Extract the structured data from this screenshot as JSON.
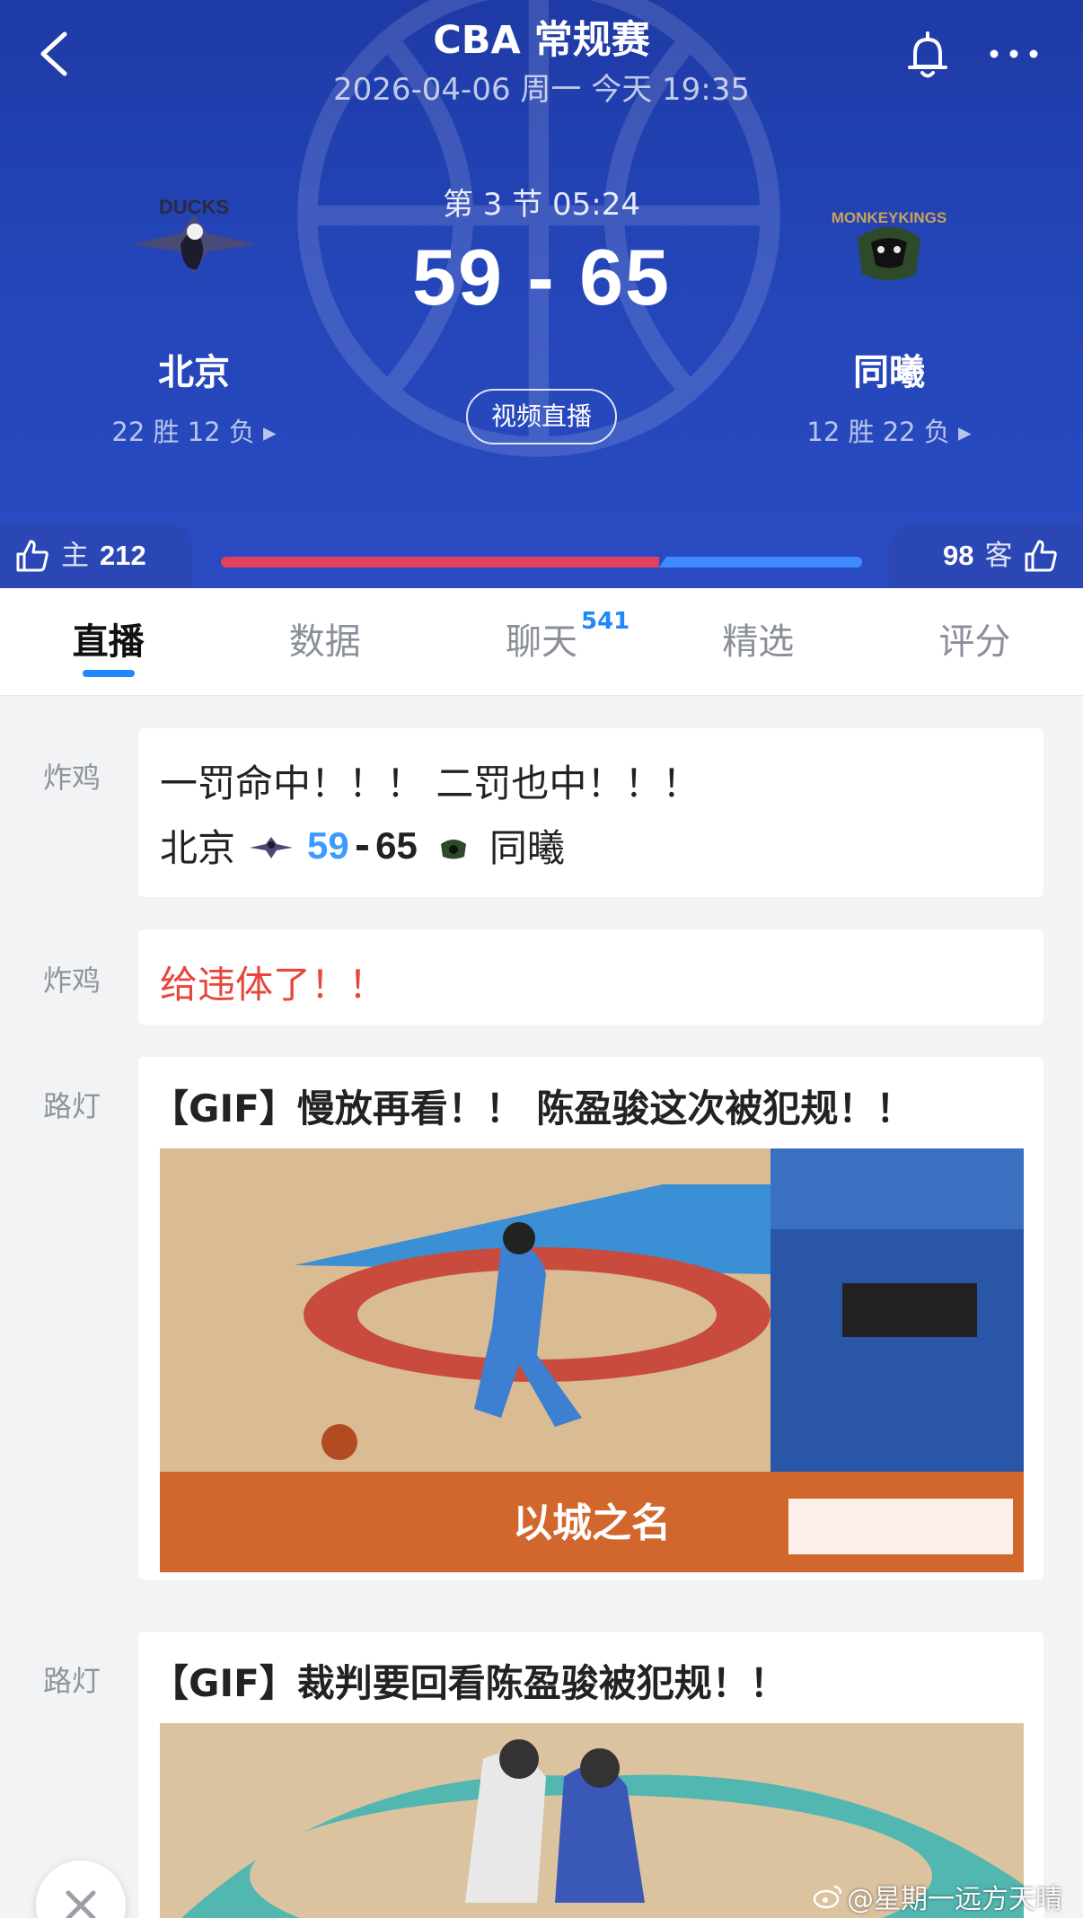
{
  "header": {
    "title": "CBA 常规赛",
    "subtitle": "2026-04-06 周一 今天 19:35",
    "period": "第 3 节 05:24",
    "score": "59 - 65",
    "video_button": "视频直播"
  },
  "home_team": {
    "name": "北京",
    "record": "22 胜 12 负",
    "logo_text": "DUCKS"
  },
  "away_team": {
    "name": "同曦",
    "record": "12 胜 22 负",
    "logo_text": "MONKEYKINGS"
  },
  "likes": {
    "home_label": "主",
    "home_count": "212",
    "away_label": "客",
    "away_count": "98",
    "home_share": 0.684
  },
  "tabs": [
    {
      "label": "直播",
      "badge": ""
    },
    {
      "label": "数据",
      "badge": ""
    },
    {
      "label": "聊天",
      "badge": "541"
    },
    {
      "label": "精选",
      "badge": ""
    },
    {
      "label": "评分",
      "badge": ""
    }
  ],
  "feed": [
    {
      "author": "炸鸡",
      "text": "一罚命中！！！ 二罚也中！！！",
      "score_line": {
        "home": "北京",
        "home_score": "59",
        "dash": "-",
        "away_score": "65",
        "away": "同曦"
      }
    },
    {
      "author": "炸鸡",
      "text": "给违体了！！"
    },
    {
      "author": "路灯",
      "title": "【GIF】慢放再看！！ 陈盈骏这次被犯规！！",
      "gif_caption": "以城之名"
    },
    {
      "author": "路灯",
      "title": "【GIF】裁判要回看陈盈骏被犯规！！"
    }
  ],
  "watermark": "@星期一远方天晴",
  "colors": {
    "header_bg": "#2445b8",
    "home_bar": "#e4405a",
    "away_bar": "#3d8bff",
    "accent": "#1e88ff",
    "alert_text": "#e8463a"
  }
}
